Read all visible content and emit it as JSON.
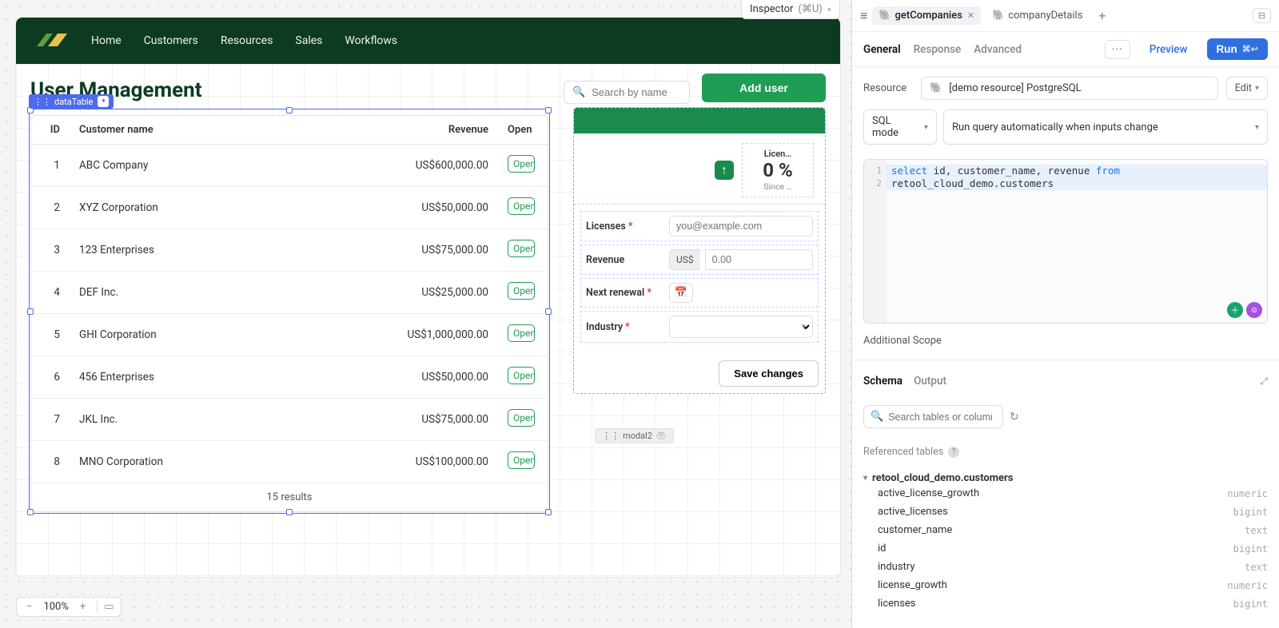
{
  "inspector_badge": {
    "label": "Inspector",
    "shortcut": "(⌘U)",
    "chev": "«"
  },
  "nav": {
    "items": [
      "Home",
      "Customers",
      "Resources",
      "Sales",
      "Workflows"
    ]
  },
  "page": {
    "title": "User Management"
  },
  "search": {
    "placeholder": "Search by name"
  },
  "add_user_label": "Add user",
  "selection_badge": {
    "grip": "⋮⋮",
    "name": "dataTable",
    "ai": "✦"
  },
  "table": {
    "columns": [
      "ID",
      "Customer name",
      "Revenue",
      "Open"
    ],
    "rows": [
      {
        "id": "1",
        "name": "ABC Company",
        "revenue": "US$600,000.00"
      },
      {
        "id": "2",
        "name": "XYZ Corporation",
        "revenue": "US$50,000.00"
      },
      {
        "id": "3",
        "name": "123 Enterprises",
        "revenue": "US$75,000.00"
      },
      {
        "id": "4",
        "name": "DEF Inc.",
        "revenue": "US$25,000.00"
      },
      {
        "id": "5",
        "name": "GHI Corporation",
        "revenue": "US$1,000,000.00"
      },
      {
        "id": "6",
        "name": "456 Enterprises",
        "revenue": "US$50,000.00"
      },
      {
        "id": "7",
        "name": "JKL Inc.",
        "revenue": "US$75,000.00"
      },
      {
        "id": "8",
        "name": "MNO Corporation",
        "revenue": "US$100,000.00"
      }
    ],
    "open_label": "Open",
    "footer": "15 results"
  },
  "detail": {
    "stat": {
      "label": "Licen…",
      "value": "0 %",
      "sub": "Since …",
      "arrow": "↑"
    },
    "fields": {
      "licenses": {
        "label": "Licenses",
        "placeholder": "you@example.com",
        "required": true
      },
      "revenue": {
        "label": "Revenue",
        "prefix": "US$",
        "placeholder": "0.00"
      },
      "next_renewal": {
        "label": "Next renewal",
        "required": true,
        "icon": "📅"
      },
      "industry": {
        "label": "Industry",
        "required": true
      }
    },
    "save": "Save changes"
  },
  "modal_pill": {
    "grip": "⋮⋮",
    "name": "modal2",
    "eye": "👁"
  },
  "zoom": {
    "minus": "−",
    "value": "100%",
    "plus": "+",
    "device": "▭"
  },
  "right": {
    "tabs": [
      {
        "icon": "🐘",
        "label": "getCompanies",
        "active": true,
        "closable": true
      },
      {
        "icon": "🐘",
        "label": "companyDetails",
        "active": false,
        "closable": false
      }
    ],
    "plus": "+",
    "collapse": "⊟",
    "subtabs": [
      "General",
      "Response",
      "Advanced"
    ],
    "subtab_active": 0,
    "dots": "···",
    "preview": "Preview",
    "run": "Run",
    "run_kbd": "⌘↩",
    "resource": {
      "label": "Resource",
      "icon": "🐘",
      "value": "[demo resource] PostgreSQL",
      "edit": "Edit"
    },
    "mode": {
      "value": "SQL mode",
      "trigger": "Run query automatically when inputs change"
    },
    "code": {
      "lines": [
        "1",
        "2"
      ],
      "text_parts": [
        "select",
        " id",
        ", customer_name",
        ", revenue ",
        "from",
        "\nretool_cloud_demo.customers"
      ]
    },
    "scope": "Additional Scope",
    "schema_tabs": [
      "Schema",
      "Output"
    ],
    "schema_active": 0,
    "schema_search": {
      "placeholder": "Search tables or column",
      "icon": "🔍",
      "refresh": "↻"
    },
    "ref_label": "Referenced tables",
    "tree": {
      "root": "retool_cloud_demo.customers",
      "cols": [
        {
          "name": "active_license_growth",
          "type": "numeric"
        },
        {
          "name": "active_licenses",
          "type": "bigint"
        },
        {
          "name": "customer_name",
          "type": "text"
        },
        {
          "name": "id",
          "type": "bigint"
        },
        {
          "name": "industry",
          "type": "text"
        },
        {
          "name": "license_growth",
          "type": "numeric"
        },
        {
          "name": "licenses",
          "type": "bigint"
        }
      ]
    }
  }
}
